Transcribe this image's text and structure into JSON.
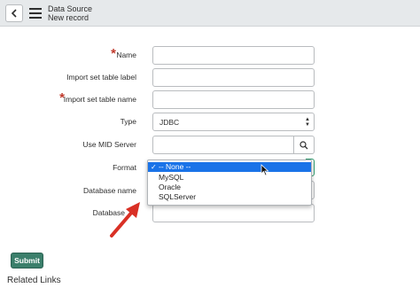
{
  "header": {
    "title": "Data Source",
    "subtitle": "New record",
    "back_icon": "chevron-left-icon",
    "menu_icon": "hamburger-menu-icon"
  },
  "form": {
    "name_label": "Name",
    "import_label_label": "Import set table label",
    "import_name_label": "Import set table name",
    "type_label": "Type",
    "type_value": "JDBC",
    "mid_label": "Use MID Server",
    "format_label": "Format",
    "db_name_label": "Database name",
    "db_port_label": "Database"
  },
  "format_dropdown": {
    "options": [
      "-- None --",
      "MySQL",
      "Oracle",
      "SQLServer"
    ],
    "selected": "-- None --"
  },
  "actions": {
    "submit_label": "Submit"
  },
  "footer": {
    "related_links": "Related Links"
  },
  "colors": {
    "required": "#c0392b",
    "submit_bg": "#3b7f6b",
    "highlight": "#1a73e8",
    "arrow": "#d93025"
  }
}
